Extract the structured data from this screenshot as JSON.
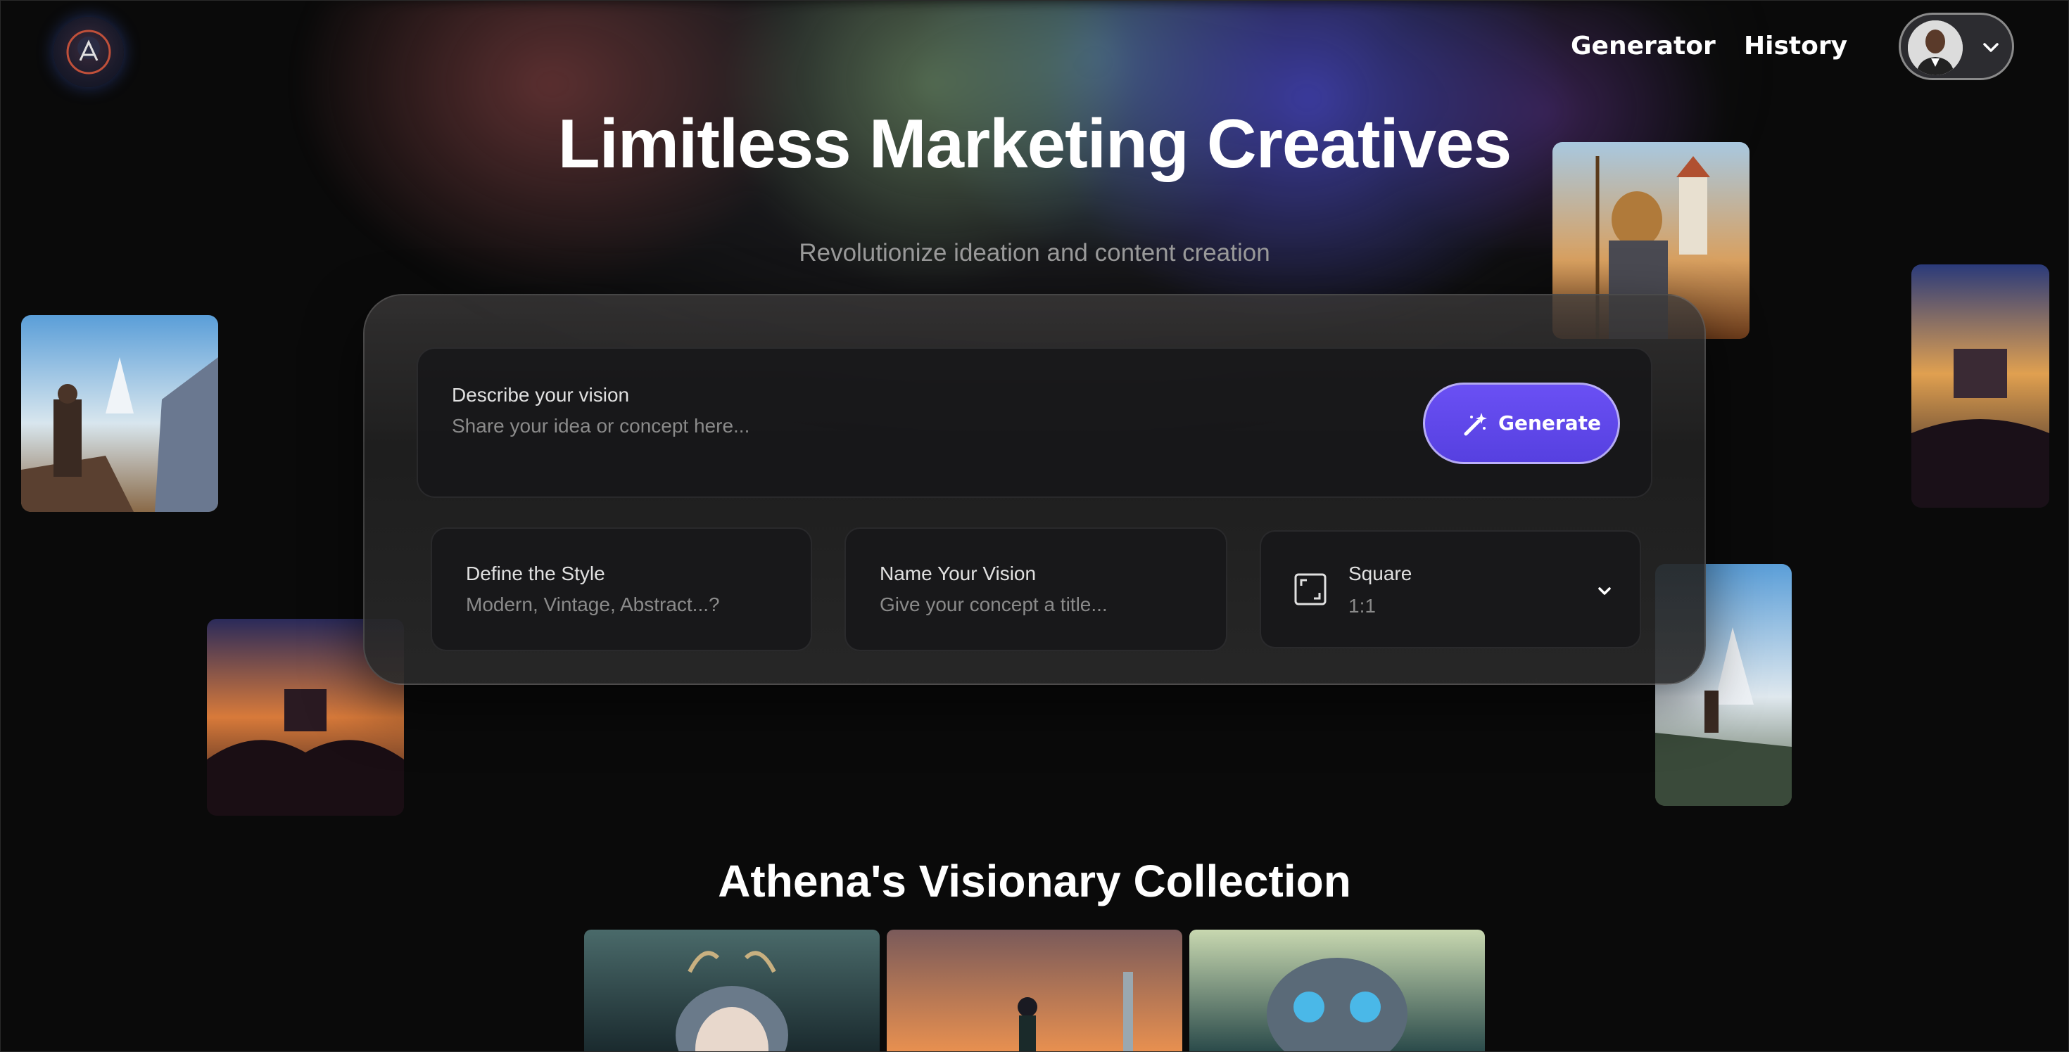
{
  "header": {
    "logo_letter": "A",
    "nav": [
      {
        "label": "Generator"
      },
      {
        "label": "History"
      }
    ]
  },
  "hero": {
    "title": "Limitless Marketing Creatives",
    "subtitle": "Revolutionize ideation and content creation"
  },
  "prompt": {
    "vision_label": "Describe your vision",
    "vision_placeholder": "Share your idea or concept here...",
    "generate_label": "Generate",
    "style_label": "Define the Style",
    "style_placeholder": "Modern, Vintage, Abstract...?",
    "name_label": "Name Your Vision",
    "name_placeholder": "Give your concept a title...",
    "aspect_label": "Square",
    "aspect_ratio": "1:1"
  },
  "collection": {
    "title": "Athena's Visionary Collection"
  },
  "colors": {
    "accent": "#5b45e8",
    "background": "#0a0a0a"
  },
  "icons": [
    "avatar",
    "chevron-down-icon",
    "magic-wand-icon",
    "aspect-ratio-icon"
  ]
}
